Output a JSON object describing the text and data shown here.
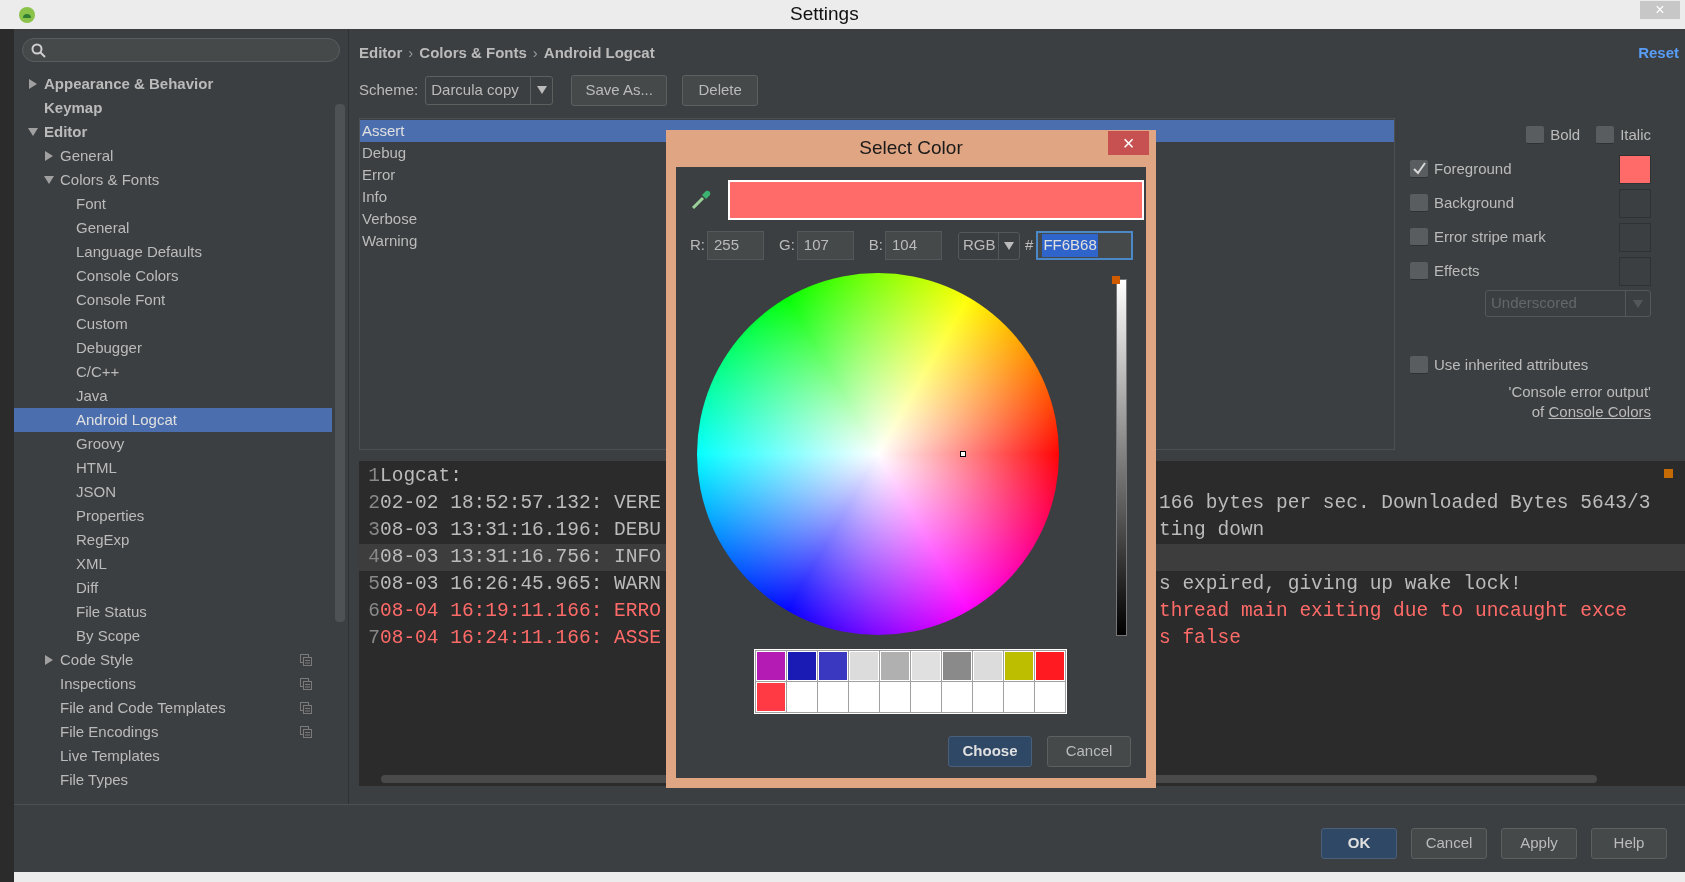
{
  "window": {
    "title": "Settings",
    "close": "×"
  },
  "sidebar": {
    "items": [
      {
        "label": "Appearance & Behavior",
        "selected": false,
        "expanded": false
      },
      {
        "label": "Keymap",
        "selected": false
      },
      {
        "label": "Editor",
        "selected": false,
        "expanded": true,
        "children": [
          {
            "label": "General",
            "selected": false,
            "expanded": false
          },
          {
            "label": "Colors & Fonts",
            "selected": false,
            "expanded": true,
            "children": [
              {
                "label": "Font",
                "selected": false
              },
              {
                "label": "General",
                "selected": false
              },
              {
                "label": "Language Defaults",
                "selected": false
              },
              {
                "label": "Console Colors",
                "selected": false
              },
              {
                "label": "Console Font",
                "selected": false
              },
              {
                "label": "Custom",
                "selected": false
              },
              {
                "label": "Debugger",
                "selected": false
              },
              {
                "label": "C/C++",
                "selected": false
              },
              {
                "label": "Java",
                "selected": false
              },
              {
                "label": "Android Logcat",
                "selected": true
              },
              {
                "label": "Groovy",
                "selected": false
              },
              {
                "label": "HTML",
                "selected": false
              },
              {
                "label": "JSON",
                "selected": false
              },
              {
                "label": "Properties",
                "selected": false
              },
              {
                "label": "RegExp",
                "selected": false
              },
              {
                "label": "XML",
                "selected": false
              },
              {
                "label": "Diff",
                "selected": false
              },
              {
                "label": "File Status",
                "selected": false
              },
              {
                "label": "By Scope",
                "selected": false
              }
            ]
          },
          {
            "label": "Code Style",
            "selected": false,
            "expanded": false,
            "per_project": true
          },
          {
            "label": "Inspections",
            "selected": false,
            "per_project": true
          },
          {
            "label": "File and Code Templates",
            "selected": false,
            "per_project": true
          },
          {
            "label": "File Encodings",
            "selected": false,
            "per_project": true
          },
          {
            "label": "Live Templates",
            "selected": false
          },
          {
            "label": "File Types",
            "selected": false
          }
        ]
      }
    ]
  },
  "breadcrumb": {
    "parts": [
      "Editor",
      "Colors & Fonts",
      "Android Logcat"
    ],
    "separator": "›"
  },
  "reset_link": "Reset",
  "scheme": {
    "label": "Scheme:",
    "value": "Darcula copy",
    "buttons": [
      "Save As...",
      "Delete"
    ]
  },
  "categories": [
    {
      "label": "Assert",
      "selected": true
    },
    {
      "label": "Debug",
      "selected": false
    },
    {
      "label": "Error",
      "selected": false
    },
    {
      "label": "Info",
      "selected": false
    },
    {
      "label": "Verbose",
      "selected": false
    },
    {
      "label": "Warning",
      "selected": false
    }
  ],
  "font_style": [
    {
      "label": "Bold",
      "checked": false
    },
    {
      "label": "Italic",
      "checked": false
    }
  ],
  "attributes": [
    {
      "label": "Foreground",
      "checked": true,
      "color": "#ff6b68"
    },
    {
      "label": "Background",
      "checked": false
    },
    {
      "label": "Error stripe mark",
      "checked": false
    },
    {
      "label": "Effects",
      "checked": false
    }
  ],
  "effect_type": {
    "value": "Underscored",
    "disabled": true
  },
  "inherit": {
    "label": "Use inherited attributes",
    "checked": false,
    "note_text": "'Console error output'",
    "note_of": "of",
    "note_link": "Console Colors"
  },
  "preview": {
    "lines": [
      {
        "number": "1",
        "left": "Logcat:",
        "kind": "plain",
        "current": false
      },
      {
        "number": "2",
        "left": "02-02 18:52:57.132: VERE",
        "right": "166 bytes per sec. Downloaded Bytes 5643/3",
        "kind": "plain",
        "current": false
      },
      {
        "number": "3",
        "left": "08-03 13:31:16.196: DEBU",
        "right": "ting down",
        "kind": "plain",
        "current": false
      },
      {
        "number": "4",
        "left": "08-03 13:31:16.756: INFO",
        "kind": "plain",
        "current": true
      },
      {
        "number": "5",
        "left": "08-03 16:26:45.965: WARN",
        "right": "s expired, giving up wake lock!",
        "kind": "plain",
        "current": false
      },
      {
        "number": "6",
        "left": "08-04 16:19:11.166: ERRO",
        "right": "thread main exiting due to uncaught exce",
        "kind": "error",
        "current": false
      },
      {
        "number": "7",
        "left": "08-04 16:24:11.166: ASSE",
        "right": "s false",
        "kind": "error",
        "current": false
      }
    ]
  },
  "color_dialog": {
    "title": "Select Color",
    "close": "×",
    "preview": {
      "color": "#ff6b68"
    },
    "brightness": {
      "level": 1
    },
    "channels": [
      {
        "label": "R:",
        "value": "255"
      },
      {
        "label": "G:",
        "value": "107"
      },
      {
        "label": "B:",
        "value": "104"
      }
    ],
    "mode": "RGB",
    "hash": "#",
    "hex": "FF6B68",
    "recent": [
      {
        "color": "#b41ab4"
      },
      {
        "color": "#1a1ab4"
      },
      {
        "color": "#3a38c0"
      },
      {
        "color": "#dcdcdc"
      },
      {
        "color": "#b0b0b0"
      },
      {
        "color": "#e0e0e0"
      },
      {
        "color": "#8a8a8a"
      },
      {
        "color": "#dcdcdc"
      },
      {
        "color": "#bebe00"
      },
      {
        "color": "#ff1a22"
      },
      {
        "color": "#ff3a44"
      },
      {
        "color": "#ffffff"
      },
      {
        "color": "#ffffff"
      },
      {
        "color": "#ffffff"
      },
      {
        "color": "#ffffff"
      },
      {
        "color": "#ffffff"
      },
      {
        "color": "#ffffff"
      },
      {
        "color": "#ffffff"
      },
      {
        "color": "#ffffff"
      },
      {
        "color": "#ffffff"
      }
    ],
    "buttons": [
      {
        "label": "Choose",
        "default": true
      },
      {
        "label": "Cancel",
        "default": false
      }
    ]
  },
  "footer_buttons": [
    {
      "label": "OK",
      "default": true
    },
    {
      "label": "Cancel",
      "default": false
    },
    {
      "label": "Apply",
      "default": false
    },
    {
      "label": "Help",
      "default": false
    }
  ]
}
